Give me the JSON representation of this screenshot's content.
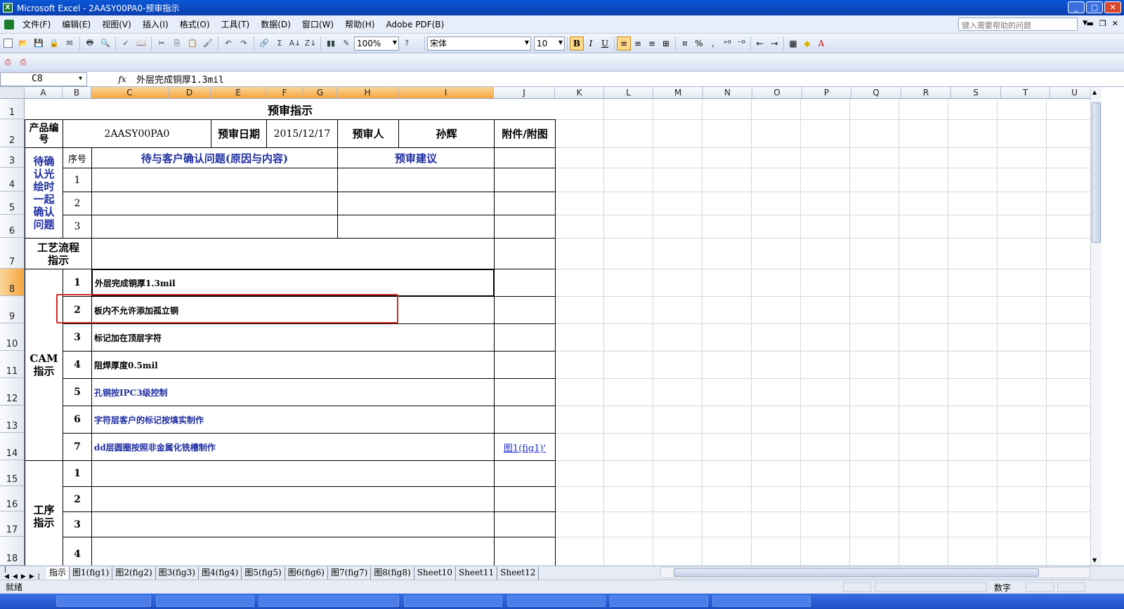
{
  "window": {
    "title": "Microsoft Excel - 2AASY00PA0-预审指示"
  },
  "menu": [
    "文件(F)",
    "编辑(E)",
    "视图(V)",
    "插入(I)",
    "格式(O)",
    "工具(T)",
    "数据(D)",
    "窗口(W)",
    "帮助(H)",
    "Adobe PDF(B)"
  ],
  "help_placeholder": "键入需要帮助的问题",
  "toolbar": {
    "zoom": "100%",
    "font": "宋体",
    "size": "10",
    "bold": "B",
    "italic": "I",
    "underline": "U",
    "percent": "%",
    "comma": ","
  },
  "formula_bar": {
    "cell_ref": "C8",
    "fx": "fx",
    "value": "外层完成铜厚1.3mil"
  },
  "columns": [
    "A",
    "B",
    "C",
    "D",
    "E",
    "F",
    "G",
    "H",
    "I",
    "J",
    "K",
    "L",
    "M",
    "N",
    "O",
    "P",
    "Q",
    "R",
    "S",
    "T",
    "U"
  ],
  "rows": [
    "1",
    "2",
    "3",
    "4",
    "5",
    "6",
    "7",
    "8",
    "9",
    "10",
    "11",
    "12",
    "13",
    "14",
    "15",
    "16",
    "17",
    "18"
  ],
  "form": {
    "title": "预审指示",
    "product_label": "产品编号",
    "product_value": "2AASY00PA0",
    "date_label": "预审日期",
    "date_value": "2015/12/17",
    "reviewer_label": "预审人",
    "reviewer_value": "孙辉",
    "attach_label": "附件/附图",
    "confirm_label": "待确认光绘时一起确认问题",
    "seq_label": "序号",
    "issues_label": "待与客户确认问题(原因与内容)",
    "suggest_label": "预审建议",
    "confirm_rows": [
      "1",
      "2",
      "3"
    ],
    "process_label": "工艺流程指示",
    "cam_label": "CAM指示",
    "cam_items": [
      {
        "n": "1",
        "text": "外层完成铜厚1.3mil"
      },
      {
        "n": "2",
        "text": "板内不允许添加孤立铜"
      },
      {
        "n": "3",
        "text": "标记加在顶层字符"
      },
      {
        "n": "4",
        "text": "阻焊厚度0.5mil"
      },
      {
        "n": "5",
        "text": "孔铜按IPC3级控制"
      },
      {
        "n": "6",
        "text": "字符层客户的标记按填实制作"
      },
      {
        "n": "7",
        "text": "dd层圆圈按照非金属化铣槽制作"
      }
    ],
    "cam_link": "图1(fig1)'",
    "process_step_label": "工序指示",
    "process_rows": [
      "1",
      "2",
      "3",
      "4"
    ]
  },
  "sheet_tabs": [
    "指示",
    "图1(fig1)",
    "图2(fig2)",
    "图3(fig3)",
    "图4(fig4)",
    "图5(fig5)",
    "图6(fig6)",
    "图7(fig7)",
    "图8(fig8)",
    "Sheet10",
    "Sheet11",
    "Sheet12"
  ],
  "status": {
    "ready": "就绪",
    "mode": "数字"
  }
}
